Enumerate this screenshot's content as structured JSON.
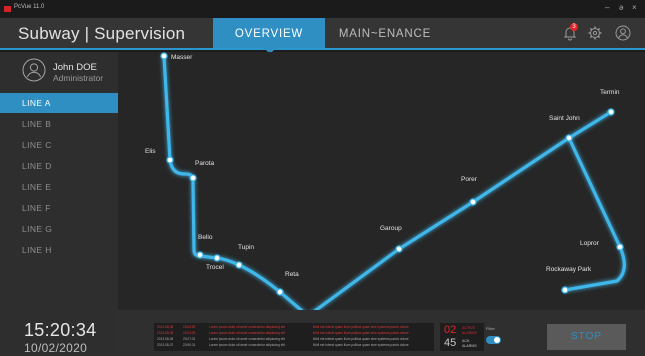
{
  "window": {
    "app_name": "PcVue 11.0",
    "controls": {
      "minimize": "–",
      "maximize": "ə",
      "close": "×"
    }
  },
  "header": {
    "title": "Subway | Supervision",
    "tabs": [
      {
        "label": "OVERVIEW",
        "active": true
      },
      {
        "label": "MAIN~ENANCE",
        "active": false
      }
    ],
    "notification_count": "3",
    "icons": [
      "bell-icon",
      "gear-icon",
      "user-profile-icon"
    ]
  },
  "user": {
    "name": "John DOE",
    "role": "Administrator"
  },
  "lines": [
    {
      "label": "LINE A",
      "active": true
    },
    {
      "label": "LINE B",
      "active": false
    },
    {
      "label": "LINE C",
      "active": false
    },
    {
      "label": "LINE D",
      "active": false
    },
    {
      "label": "LINE E",
      "active": false
    },
    {
      "label": "LINE F",
      "active": false
    },
    {
      "label": "LINE G",
      "active": false
    },
    {
      "label": "LINE H",
      "active": false
    }
  ],
  "clock": {
    "time": "15:20:34",
    "date": "10/02/2020"
  },
  "map": {
    "line_color": "#3fb7ea",
    "stations": [
      "Masser",
      "Elis",
      "Parota",
      "Bello",
      "Tupin",
      "Trocel",
      "Reta",
      "Garoup",
      "Porer",
      "Saint John",
      "Termin",
      "Lopror",
      "Rockaway Park"
    ]
  },
  "alarms": {
    "rows": [
      {
        "date": "2013-08-08",
        "time": "23:03:35",
        "text_a": "Lorem ipsum dolor sit amet consectetur adipiscing elit",
        "text_b": "Nihil est tolerat quam illum politica quam sine systema parcis dolore",
        "color": "#d83a3a"
      },
      {
        "date": "2013-08-08",
        "time": "23:03:35",
        "text_a": "Lorem ipsum dolor sit amet consectetur adipiscing elit",
        "text_b": "Nihil est tolerat quam illum politica quam sine systema parcis dolore",
        "color": "#d83a3a"
      },
      {
        "date": "2013-08-08",
        "time": "23:27:32",
        "text_a": "Lorem ipsum dolor sit amet consectetur adipiscing elit",
        "text_b": "Nihil est tolerat quam illum politica quam sine systema parcis dolore",
        "color": "#a9a9a9"
      },
      {
        "date": "2013-08-07",
        "time": "23:50:31",
        "text_a": "Lorem ipsum dolor sit amet consectetur adipiscing elit",
        "text_b": "Nihil est tolerat quam illum politica quam sine systema parcis dolore",
        "color": "#a9a9a9"
      }
    ],
    "active_count": "02",
    "active_label": "ACTIVE ALARMS",
    "ack_count": "45",
    "ack_label": "ACK. ALARMS",
    "filter_label": "Filter",
    "filter_on": true
  },
  "stop_label": "STOP",
  "colors": {
    "accent": "#2f8fc3",
    "alarm": "#e0242b",
    "line": "#3fb7ea"
  }
}
